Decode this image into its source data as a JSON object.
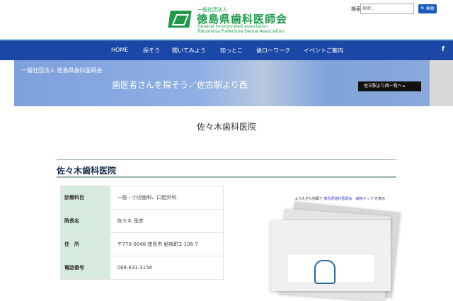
{
  "header": {
    "logo_small": "一般社団法人",
    "logo_main": "徳島県歯科医師会",
    "logo_en1": "General incorporated association",
    "logo_en2": "Tokushima Prefecture Dental Association",
    "search_label": "検索",
    "search_placeholder": "検索...",
    "search_button": "🔍検索"
  },
  "nav": {
    "items": [
      "HOME",
      "探そう",
      "聞いてみよう",
      "知っとこ",
      "歯ローワーク",
      "イベントご案内"
    ],
    "facebook": "f"
  },
  "banner": {
    "logo": "一般社団法人 徳島県歯科医師会",
    "title": "歯医者さんを探そう／佐古駅より西",
    "button": "佐古駅より西一覧へ ▸"
  },
  "page_title": "佐々木歯科医院",
  "clinic": {
    "name": "佐々木歯科医院",
    "rows": [
      {
        "label": "診療科目",
        "value": "一般・小児歯科、口腔外科"
      },
      {
        "label": "院長名",
        "value": "佐々木 岳彦"
      },
      {
        "label": "住　所",
        "value": "〒770-0046 徳島市 鮎喰町2-106-7"
      },
      {
        "label": "電話番号",
        "value": "088-631-3156"
      }
    ]
  },
  "map": {
    "prefix": "より大きな地図で",
    "link": "徳島県歯科医師会　病院マップ",
    "suffix": "を表示"
  }
}
